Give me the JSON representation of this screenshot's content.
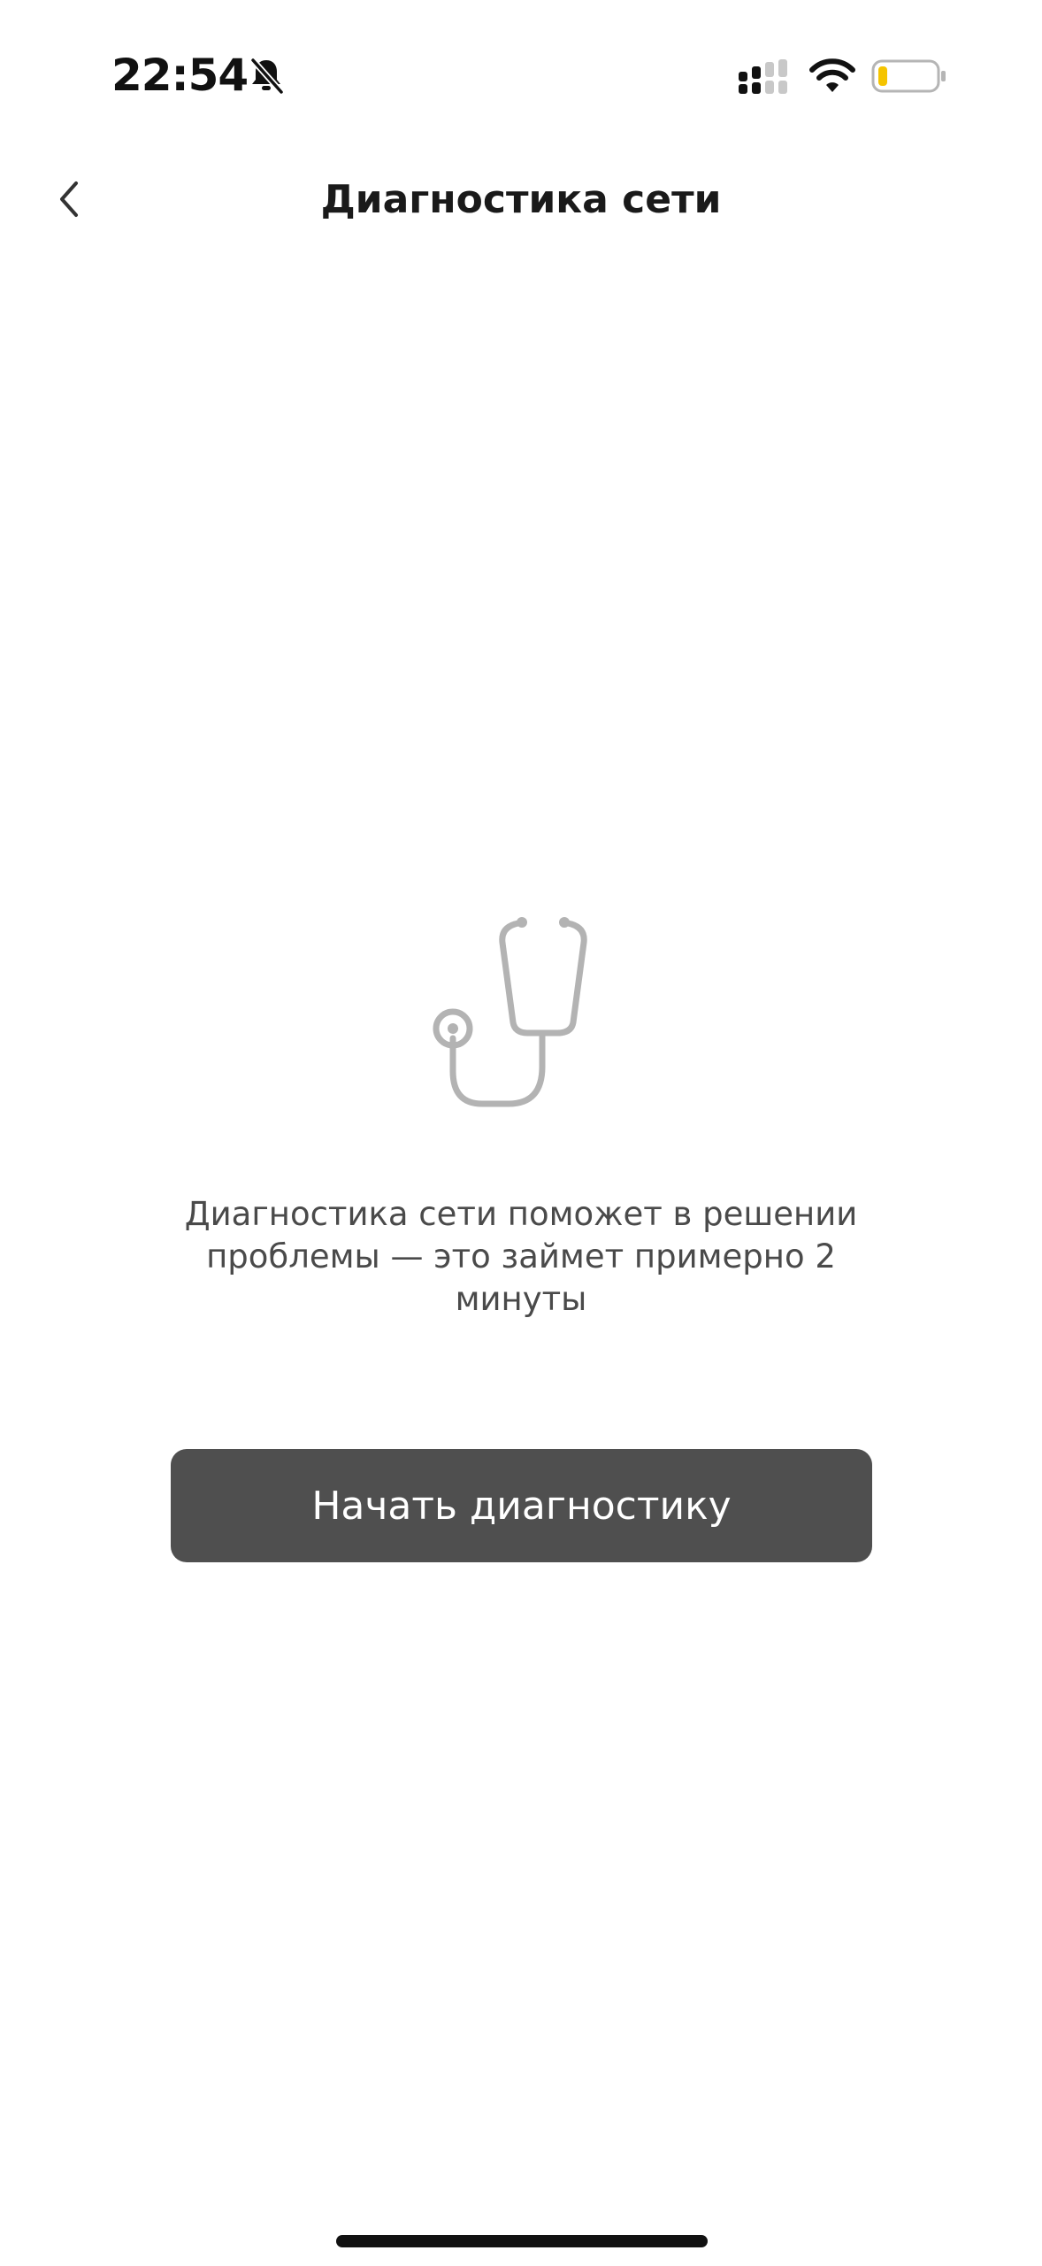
{
  "status_bar": {
    "time": "22:54",
    "icons": [
      "bell-slash-icon",
      "cellular-signal-icon",
      "wifi-icon",
      "battery-low-icon"
    ],
    "battery_accent": "#f5c400"
  },
  "nav": {
    "back_icon": "chevron-left-icon",
    "title": "Диагностика сети"
  },
  "main": {
    "illustration": "stethoscope-icon",
    "description": "Диагностика сети поможет в решении проблемы — это займет примерно 2 минуты",
    "start_button_label": "Начать диагностику"
  },
  "colors": {
    "button_bg": "#4f4f4f",
    "button_text": "#ffffff",
    "icon_gray": "#b3b3b3",
    "text_gray": "#4a4a4a"
  }
}
